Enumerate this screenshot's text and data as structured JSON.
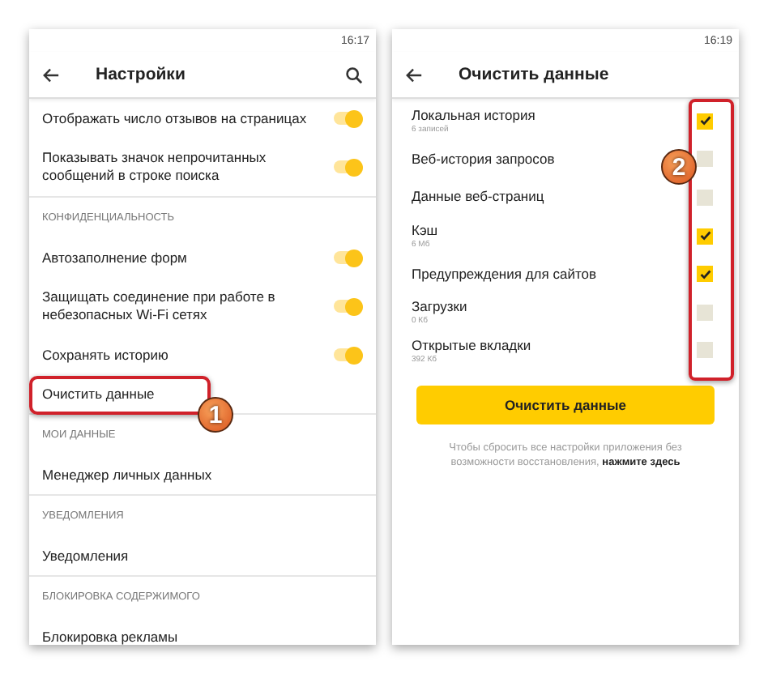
{
  "left_screen": {
    "time": "16:17",
    "title": "Настройки",
    "items": [
      {
        "kind": "toggle",
        "label": "Отображать число отзывов на страницах",
        "on": true
      },
      {
        "kind": "toggle",
        "label": "Показывать значок непрочитанных сообщений в строке поиска",
        "on": true
      },
      {
        "kind": "section",
        "label": "КОНФИДЕНЦИАЛЬНОСТЬ"
      },
      {
        "kind": "toggle",
        "label": "Автозаполнение форм",
        "on": true
      },
      {
        "kind": "toggle",
        "label": "Защищать соединение при работе в небезопасных Wi-Fi сетях",
        "on": true
      },
      {
        "kind": "toggle",
        "label": "Сохранять историю",
        "on": true
      },
      {
        "kind": "link",
        "label": "Очистить данные",
        "callout": "1"
      },
      {
        "kind": "section",
        "label": "МОИ ДАННЫЕ"
      },
      {
        "kind": "link",
        "label": "Менеджер личных данных"
      },
      {
        "kind": "section",
        "label": "УВЕДОМЛЕНИЯ"
      },
      {
        "kind": "link",
        "label": "Уведомления"
      },
      {
        "kind": "section",
        "label": "БЛОКИРОВКА СОДЕРЖИМОГО"
      },
      {
        "kind": "link",
        "label": "Блокировка рекламы"
      }
    ]
  },
  "right_screen": {
    "time": "16:19",
    "title": "Очистить данные",
    "checkbox_callout": "2",
    "items": [
      {
        "label": "Локальная история",
        "detail": "6 записей",
        "checked": true
      },
      {
        "label": "Веб-история запросов",
        "checked": false
      },
      {
        "label": "Данные веб-страниц",
        "checked": false
      },
      {
        "label": "Кэш",
        "detail": "6 Мб",
        "checked": true
      },
      {
        "label": "Предупреждения для сайтов",
        "checked": true
      },
      {
        "label": "Загрузки",
        "detail": "0 Кб",
        "checked": false
      },
      {
        "label": "Открытые вкладки",
        "detail": "392 Кб",
        "checked": false
      }
    ],
    "button": "Очистить данные",
    "note": "Чтобы сбросить все настройки приложения без возможности восстановления,",
    "note_link": "нажмите здесь"
  }
}
